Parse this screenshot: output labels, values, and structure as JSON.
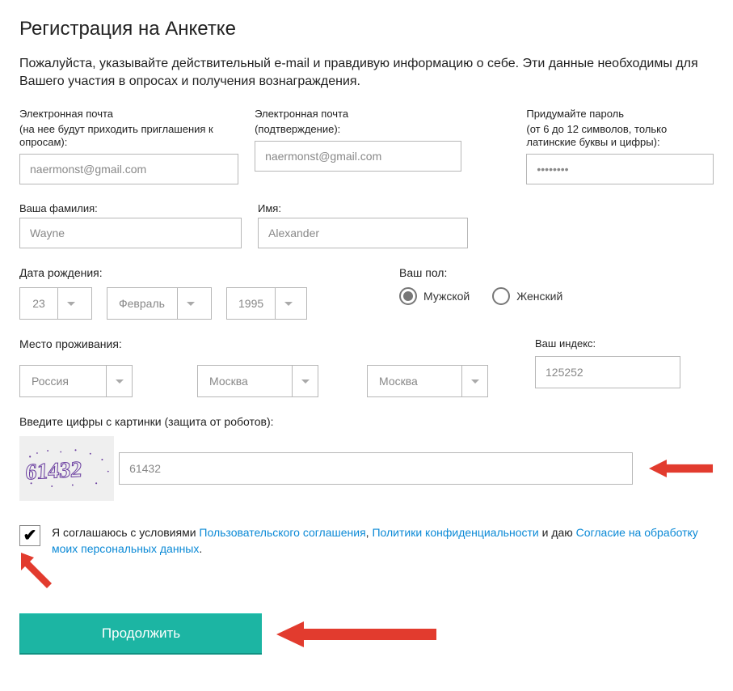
{
  "page_title": "Регистрация на Анкетке",
  "intro": "Пожалуйста, указывайте действительный e-mail и правдивую информацию о себе. Эти данные необходимы для Вашего участия в опросах и получения вознаграждения.",
  "email": {
    "label": "Электронная почта",
    "note": "(на нее будут приходить приглашения к опросам):",
    "value": "naermonst@gmail.com"
  },
  "email_confirm": {
    "label": "Электронная почта",
    "note": "(подтверждение):",
    "value": "naermonst@gmail.com"
  },
  "password": {
    "label": "Придумайте пароль",
    "note": "(от 6 до 12 символов, только латинские буквы и цифры):",
    "value": "••••••••"
  },
  "surname": {
    "label": "Ваша фамилия:",
    "value": "Wayne"
  },
  "name": {
    "label": "Имя:",
    "value": "Alexander"
  },
  "dob": {
    "label": "Дата рождения:",
    "day": "23",
    "month": "Февраль",
    "year": "1995"
  },
  "gender": {
    "label": "Ваш пол:",
    "male": "Мужской",
    "female": "Женский",
    "selected": "male"
  },
  "place": {
    "label": "Место проживания:",
    "country": "Россия",
    "region": "Москва",
    "city": "Москва"
  },
  "zip": {
    "label": "Ваш индекс:",
    "value": "125252"
  },
  "captcha": {
    "label": "Введите цифры с картинки (защита от роботов):",
    "image_text": "61432",
    "value": "61432"
  },
  "consent": {
    "checked": true,
    "t1": "Я соглашаюсь с условиями ",
    "link1": "Пользовательского соглашения",
    "sep1": ", ",
    "link2": "Политики конфиденциальности",
    "t2": " и даю ",
    "link3": "Согласие на обработку моих персональных данных",
    "dot": "."
  },
  "submit_label": "Продолжить"
}
